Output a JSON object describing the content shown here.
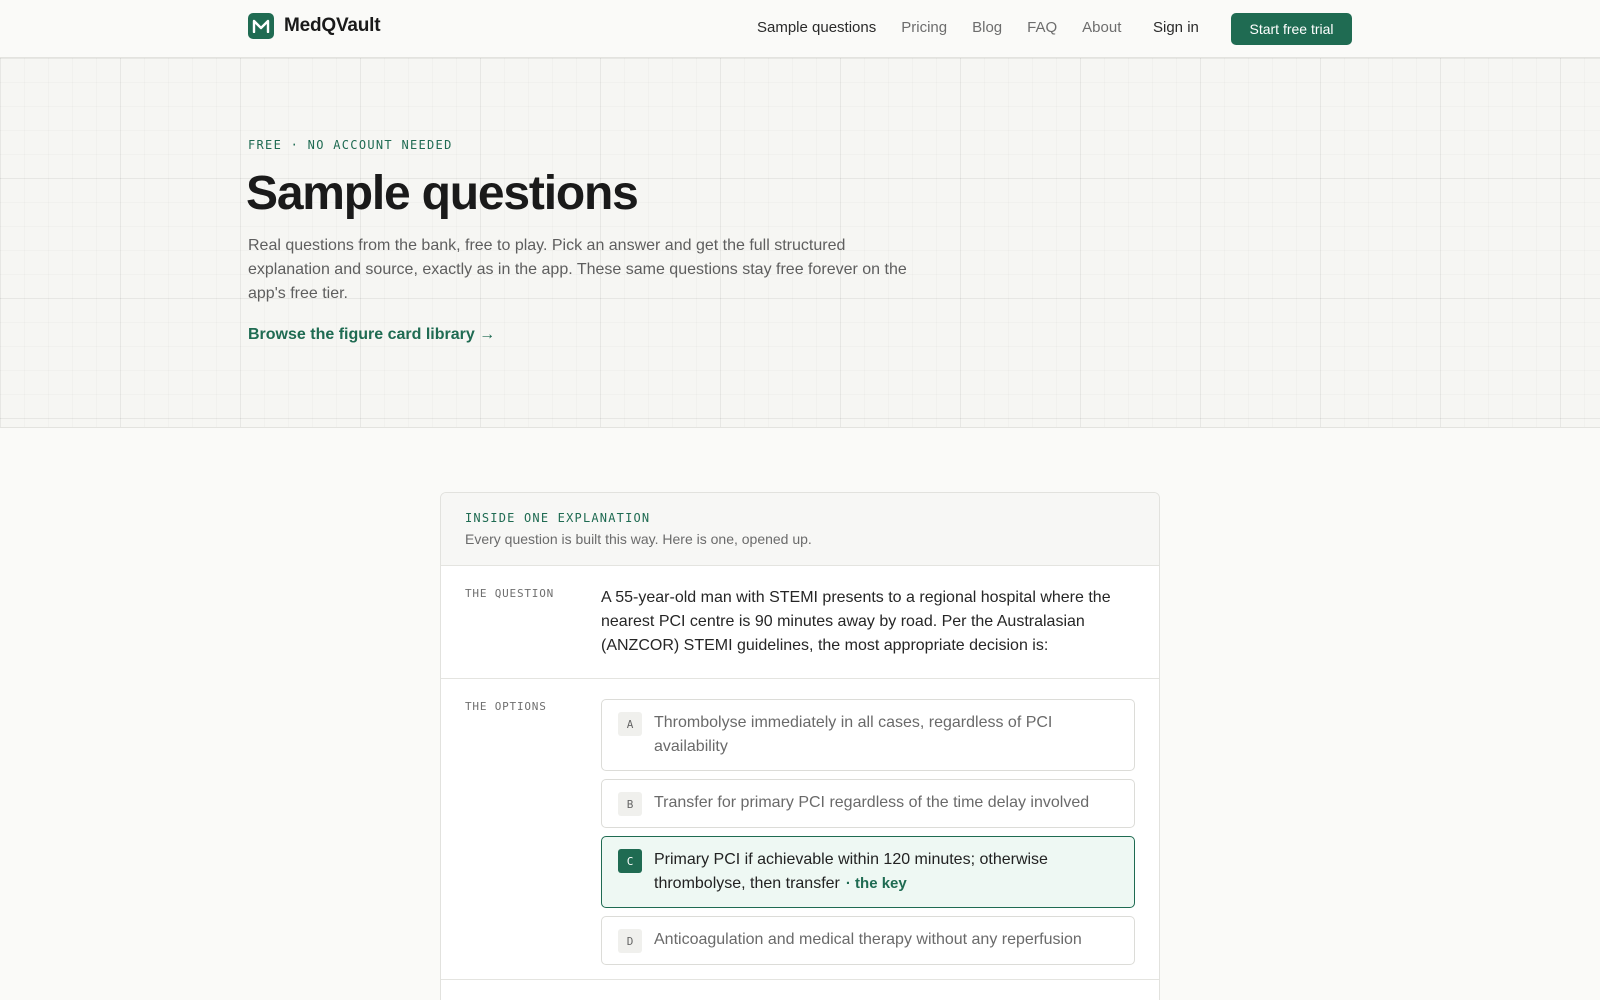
{
  "nav": {
    "brand": "MedQVault",
    "links": [
      {
        "label": "Sample questions",
        "active": true
      },
      {
        "label": "Pricing"
      },
      {
        "label": "Blog"
      },
      {
        "label": "FAQ"
      },
      {
        "label": "About"
      }
    ],
    "signin": "Sign in",
    "cta": "Start free trial"
  },
  "hero": {
    "eyebrow": "FREE · NO ACCOUNT NEEDED",
    "title": "Sample questions",
    "description": "Real questions from the bank, free to play. Pick an answer and get the full structured explanation and source, exactly as in the app. These same questions stay free forever on the app's free tier.",
    "link": "Browse the figure card library →"
  },
  "card": {
    "eyebrow": "INSIDE ONE EXPLANATION",
    "subtitle": "Every question is built this way. Here is one, opened up.",
    "question_label": "THE QUESTION",
    "question": "A 55-year-old man with STEMI presents to a regional hospital where the nearest PCI centre is 90 minutes away by road. Per the Australasian (ANZCOR) STEMI guidelines, the most appropriate decision is:",
    "options_label": "THE OPTIONS",
    "options": [
      {
        "letter": "A",
        "text": "Thrombolyse immediately in all cases, regardless of PCI availability"
      },
      {
        "letter": "B",
        "text": "Transfer for primary PCI regardless of the time delay involved"
      },
      {
        "letter": "C",
        "text": "Primary PCI if achievable within 120 minutes; otherwise thrombolyse, then transfer",
        "tag": "· the key"
      },
      {
        "letter": "D",
        "text": "Anticoagulation and medical therapy without any reperfusion"
      }
    ]
  },
  "colors": {
    "accent": "#1f6b52",
    "correct_bg": "#eef8f3"
  }
}
